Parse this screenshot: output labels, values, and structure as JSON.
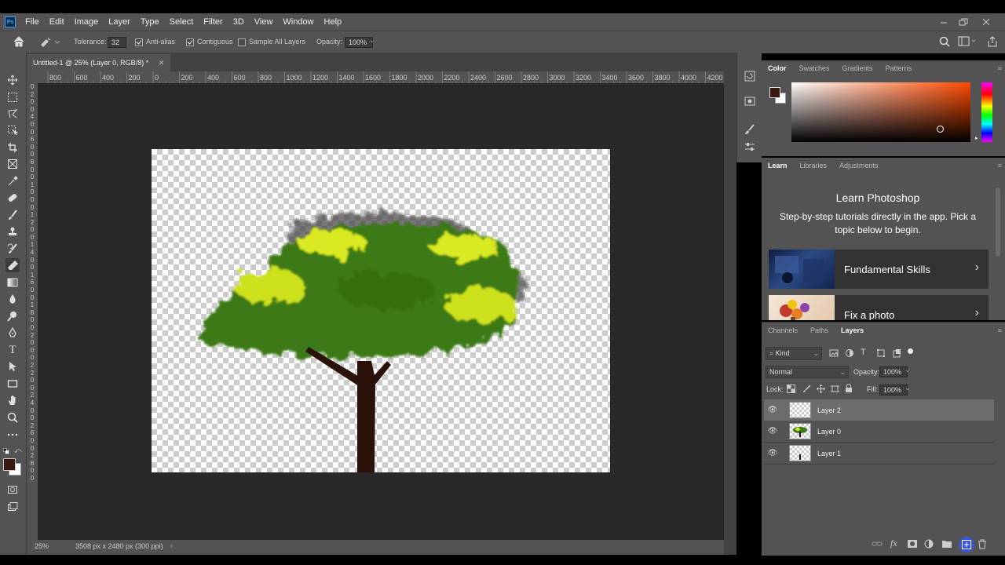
{
  "menubar": {
    "app_icon": "Ps",
    "items": [
      "File",
      "Edit",
      "Image",
      "Layer",
      "Type",
      "Select",
      "Filter",
      "3D",
      "View",
      "Window",
      "Help"
    ]
  },
  "options": {
    "tolerance_label": "Tolerance:",
    "tolerance_value": "32",
    "antialias_label": "Anti-alias",
    "contiguous_label": "Contiguous",
    "sample_all_label": "Sample All Layers",
    "opacity_label": "Opacity:",
    "opacity_value": "100%"
  },
  "document": {
    "tab_title": "Untitled-1 @ 25% (Layer 0, RGB/8) *",
    "zoom": "25%",
    "doc_info": "3508 px x 2480 px (300 ppi)"
  },
  "ruler": {
    "h_labels": [
      "800",
      "600",
      "400",
      "200",
      "0",
      "200",
      "400",
      "600",
      "800",
      "1000",
      "1200",
      "1400",
      "1600",
      "1800",
      "2000",
      "2200",
      "2400",
      "2600",
      "2800",
      "3000",
      "3200",
      "3400",
      "3600",
      "3800",
      "4000",
      "4200"
    ],
    "v_labels": [
      "0",
      "2",
      "0",
      "0",
      "4",
      "0",
      "0",
      "6",
      "0",
      "0",
      "8",
      "0",
      "0",
      "1",
      "0",
      "0",
      "0",
      "1",
      "2",
      "0",
      "0",
      "1",
      "4",
      "0",
      "0",
      "1",
      "6",
      "0",
      "0",
      "1",
      "8",
      "0",
      "0",
      "2",
      "0",
      "0",
      "0",
      "2",
      "2",
      "0",
      "0",
      "2",
      "4",
      "0",
      "0",
      "2",
      "6",
      "0",
      "0",
      "2",
      "8",
      "0",
      "0"
    ]
  },
  "color_panel": {
    "tabs": [
      "Color",
      "Swatches",
      "Gradients",
      "Patterns"
    ],
    "fg_color": "#3a1a0e",
    "bg_color": "#ffffff",
    "hue_color": "#ff4a00"
  },
  "learn_panel": {
    "tabs": [
      "Learn",
      "Libraries",
      "Adjustments"
    ],
    "title": "Learn Photoshop",
    "description": "Step-by-step tutorials directly in the app. Pick a topic below to begin.",
    "cards": [
      {
        "title": "Fundamental Skills"
      },
      {
        "title": "Fix a photo"
      }
    ]
  },
  "layers_panel": {
    "tabs": [
      "Channels",
      "Paths",
      "Layers"
    ],
    "filter_label": "Kind",
    "blend_mode": "Normal",
    "opacity_label": "Opacity:",
    "opacity_value": "100%",
    "lock_label": "Lock:",
    "fill_label": "Fill:",
    "fill_value": "100%",
    "layers": [
      {
        "name": "Layer 2",
        "selected": true
      },
      {
        "name": "Layer 0",
        "selected": false
      },
      {
        "name": "Layer 1",
        "selected": false
      }
    ]
  }
}
